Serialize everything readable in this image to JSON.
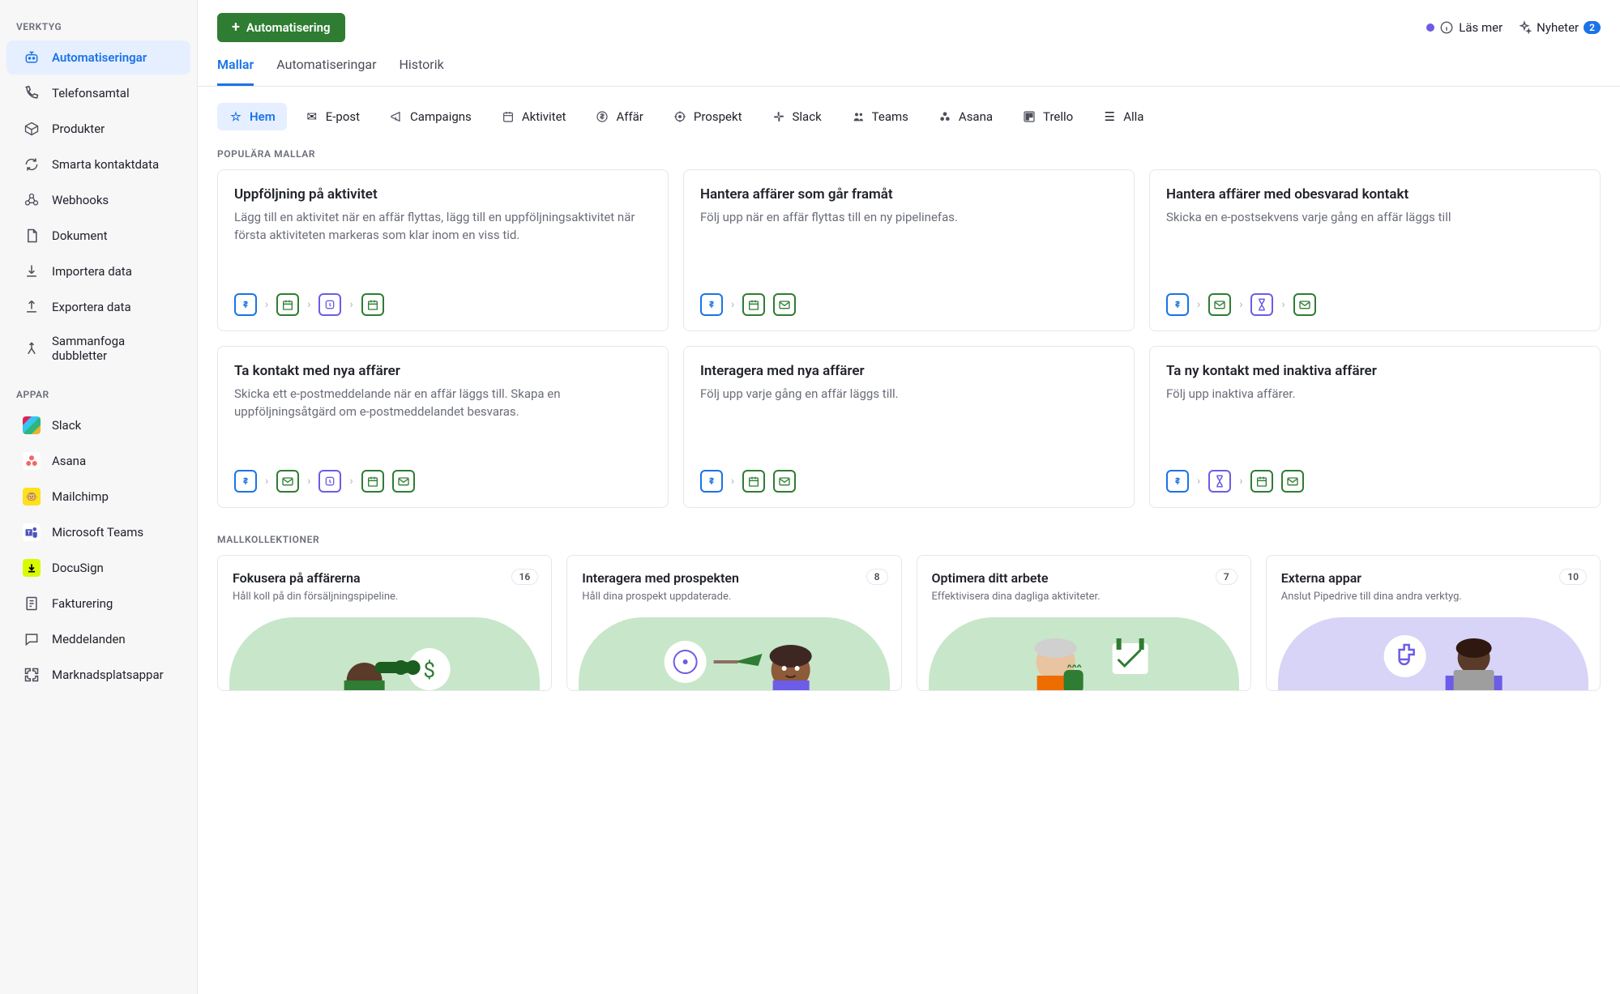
{
  "sidebar": {
    "section_tools_label": "VERKTYG",
    "section_apps_label": "APPAR",
    "items": [
      {
        "label": "Automatiseringar",
        "icon": "robot-icon",
        "active": true
      },
      {
        "label": "Telefonsamtal",
        "icon": "phone-icon"
      },
      {
        "label": "Produkter",
        "icon": "box-icon"
      },
      {
        "label": "Smarta kontaktdata",
        "icon": "refresh-icon"
      },
      {
        "label": "Webhooks",
        "icon": "webhook-icon"
      },
      {
        "label": "Dokument",
        "icon": "document-icon"
      },
      {
        "label": "Importera data",
        "icon": "import-icon"
      },
      {
        "label": "Exportera data",
        "icon": "export-icon"
      },
      {
        "label": "Sammanfoga dubbletter",
        "icon": "merge-icon"
      }
    ],
    "apps": [
      {
        "label": "Slack",
        "icon": "slack-icon"
      },
      {
        "label": "Asana",
        "icon": "asana-icon"
      },
      {
        "label": "Mailchimp",
        "icon": "mailchimp-icon"
      },
      {
        "label": "Microsoft Teams",
        "icon": "teams-icon"
      },
      {
        "label": "DocuSign",
        "icon": "docusign-icon"
      },
      {
        "label": "Fakturering",
        "icon": "invoice-icon"
      },
      {
        "label": "Meddelanden",
        "icon": "messages-icon"
      },
      {
        "label": "Marknadsplatsappar",
        "icon": "marketplace-icon"
      }
    ]
  },
  "topbar": {
    "automation_btn": "Automatisering",
    "read_more": "Läs mer",
    "news": "Nyheter",
    "news_count": "2"
  },
  "tabs": [
    {
      "label": "Mallar",
      "active": true
    },
    {
      "label": "Automatiseringar"
    },
    {
      "label": "Historik"
    }
  ],
  "categories": [
    {
      "label": "Hem",
      "icon": "star-icon",
      "active": true
    },
    {
      "label": "E-post",
      "icon": "mail-icon"
    },
    {
      "label": "Campaigns",
      "icon": "megaphone-icon"
    },
    {
      "label": "Aktivitet",
      "icon": "calendar-icon"
    },
    {
      "label": "Affär",
      "icon": "deal-icon"
    },
    {
      "label": "Prospekt",
      "icon": "target-icon"
    },
    {
      "label": "Slack",
      "icon": "slack-small-icon"
    },
    {
      "label": "Teams",
      "icon": "teams-small-icon"
    },
    {
      "label": "Asana",
      "icon": "asana-small-icon"
    },
    {
      "label": "Trello",
      "icon": "trello-icon"
    },
    {
      "label": "Alla",
      "icon": "list-icon"
    }
  ],
  "popular_label": "POPULÄRA MALLAR",
  "templates": [
    {
      "title": "Uppföljning på aktivitet",
      "desc": "Lägg till en aktivitet när en affär flyttas, lägg till en uppföljningsaktivitet när första aktiviteten markeras som klar inom en viss tid.",
      "flow": [
        "deal",
        "arrow",
        "cal",
        "arrow",
        "clock",
        "arrow",
        "cal"
      ]
    },
    {
      "title": "Hantera affärer som går framåt",
      "desc": "Följ upp när en affär flyttas till en ny pipelinefas.",
      "flow": [
        "deal",
        "arrow",
        "cal",
        "mail"
      ]
    },
    {
      "title": "Hantera affärer med obesvarad kontakt",
      "desc": "Skicka en e-postsekvens varje gång en affär läggs till",
      "flow": [
        "deal",
        "arrow",
        "mail",
        "arrow",
        "hour",
        "arrow",
        "mail"
      ]
    },
    {
      "title": "Ta kontakt med nya affärer",
      "desc": "Skicka ett e-postmeddelande när en affär läggs till. Skapa en uppföljningsåtgärd om e-postmeddelandet besvaras.",
      "flow": [
        "deal",
        "arrow",
        "mail",
        "arrow",
        "clock",
        "arrow",
        "cal",
        "mail"
      ]
    },
    {
      "title": "Interagera med nya affärer",
      "desc": "Följ upp varje gång en affär läggs till.",
      "flow": [
        "deal",
        "arrow",
        "cal",
        "mail"
      ]
    },
    {
      "title": "Ta ny kontakt med inaktiva affärer",
      "desc": "Följ upp inaktiva affärer.",
      "flow": [
        "deal",
        "arrow",
        "hour",
        "arrow",
        "cal",
        "mail"
      ]
    }
  ],
  "collections_label": "MALLKOLLEKTIONER",
  "collections": [
    {
      "title": "Fokusera på affärerna",
      "desc": "Håll koll på din försäljningspipeline.",
      "count": "16",
      "bg": "green"
    },
    {
      "title": "Interagera med prospekten",
      "desc": "Håll dina prospekt uppdaterade.",
      "count": "8",
      "bg": "green"
    },
    {
      "title": "Optimera ditt arbete",
      "desc": "Effektivisera dina dagliga aktiviteter.",
      "count": "7",
      "bg": "green"
    },
    {
      "title": "Externa appar",
      "desc": "Anslut Pipedrive till dina andra verktyg.",
      "count": "10",
      "bg": "purple"
    }
  ]
}
